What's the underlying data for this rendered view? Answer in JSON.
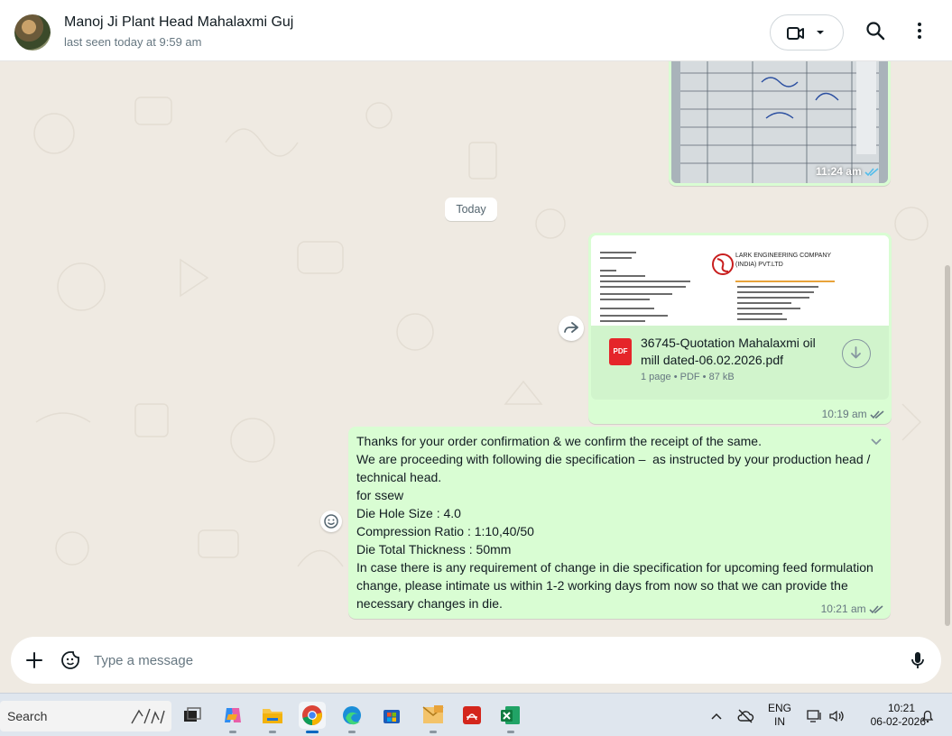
{
  "header": {
    "contact_name": "Manoj Ji Plant Head Mahalaxmi Guj",
    "status": "last seen today at 9:59 am",
    "icons": [
      "video-call-icon",
      "chevron-down-icon",
      "search-icon",
      "more-options-icon"
    ]
  },
  "messages": {
    "image_message": {
      "time": "11:24 am",
      "status": "read"
    },
    "date_divider": "Today",
    "pdf_message": {
      "preview_company": "LARK ENGINEERING COMPANY (INDIA) PVT.LTD",
      "file_name": "36745-Quotation Mahalaxmi oil mill dated-06.02.2026.pdf",
      "meta": "1 page • PDF • 87 kB",
      "icon_label": "PDF",
      "time": "10:19 am",
      "status": "read"
    },
    "text_message": {
      "text": "Thanks for your order confirmation & we confirm the receipt of the same.\nWe are proceeding with following die specification –  as instructed by your production head / technical head.\nfor ssew\nDie Hole Size : 4.0\nCompression Ratio : 1:10,40/50\nDie Total Thickness : 50mm\nIn case there is any requirement of change in die specification for upcoming feed formulation change, please intimate us within 1-2 working days from now so that we can provide the necessary changes in die.",
      "time": "10:21 am",
      "status": "read"
    }
  },
  "composer": {
    "placeholder": "Type a message"
  },
  "taskbar": {
    "search_label": "Search",
    "apps": [
      "task-view",
      "copilot",
      "file-explorer",
      "chrome",
      "edge",
      "microsoft-store",
      "outlook",
      "acrobat",
      "excel"
    ],
    "language": "ENG",
    "region": "IN",
    "time": "10:21",
    "date": "06-02-2026"
  },
  "colors": {
    "outgoing_bubble": "#d9fdd3",
    "chat_background": "#efeae2",
    "read_ticks": "#53bdeb",
    "pdf_red": "#e5252a"
  }
}
